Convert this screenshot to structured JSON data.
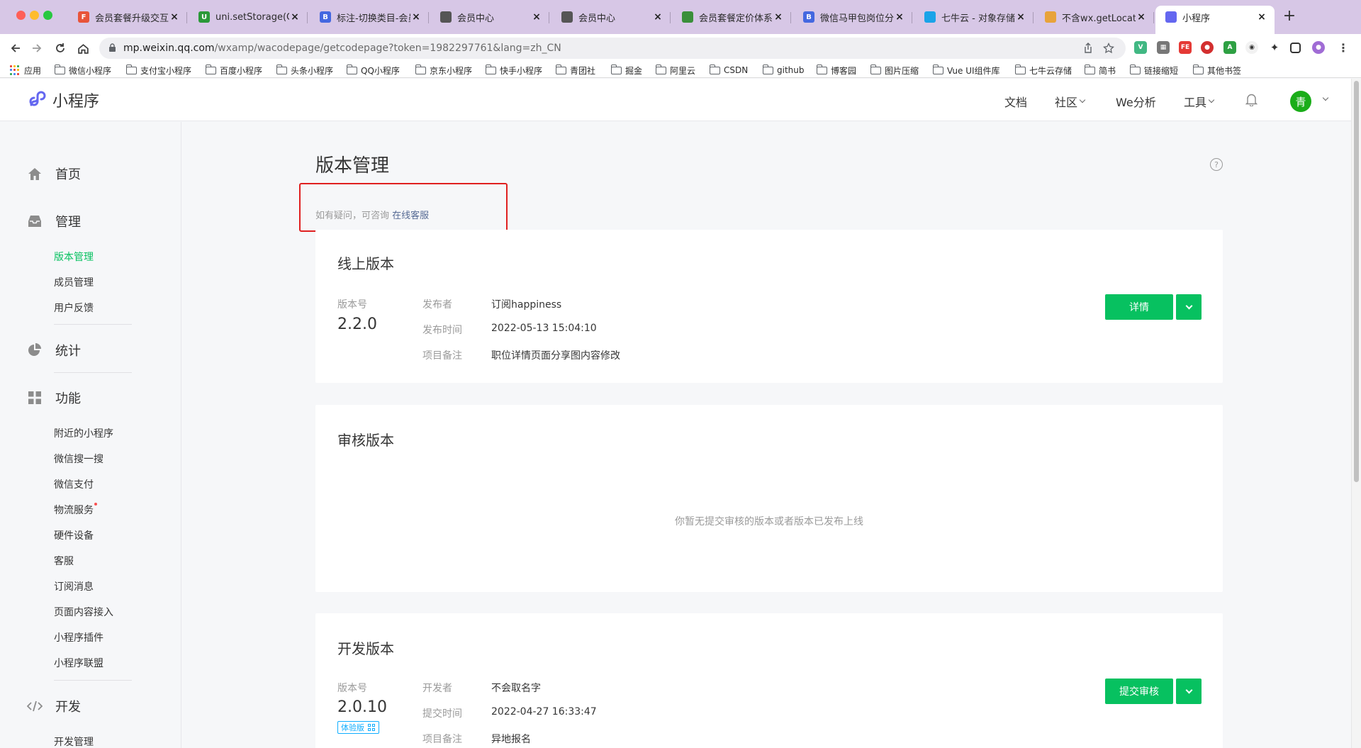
{
  "browser": {
    "tabs": [
      {
        "title": "会员套餐升级交互文档",
        "fav_color": "#e8543a",
        "fav_text": "F"
      },
      {
        "title": "uni.setStorage(OBJECT)",
        "fav_color": "#2b9939",
        "fav_text": "U"
      },
      {
        "title": "标注-切换类目-会员中心",
        "fav_color": "#4468e0",
        "fav_text": "B"
      },
      {
        "title": "会员中心",
        "fav_color": "#555555",
        "fav_text": ""
      },
      {
        "title": "会员中心",
        "fav_color": "#555555",
        "fav_text": ""
      },
      {
        "title": "会员套餐定价体系MRD",
        "fav_color": "#3a8f3a",
        "fav_text": ""
      },
      {
        "title": "微信马甲包岗位分享",
        "fav_color": "#4468e0",
        "fav_text": "B"
      },
      {
        "title": "七牛云 - 对象存储",
        "fav_color": "#1aa3e8",
        "fav_text": ""
      },
      {
        "title": "不含wx.getLocation",
        "fav_color": "#e8a33a",
        "fav_text": ""
      },
      {
        "title": "小程序",
        "fav_color": "#6467f0",
        "fav_text": ""
      }
    ],
    "close_glyph": "×",
    "newtab_glyph": "+",
    "url_host": "mp.weixin.qq.com",
    "url_path": "/wxamp/wacodepage/getcodepage?token=1982297761&lang=zh_CN",
    "bookmarks": [
      "应用",
      "微信小程序",
      "支付宝小程序",
      "百度小程序",
      "头条小程序",
      "QQ小程序",
      "京东小程序",
      "快手小程序",
      "青团社",
      "掘金",
      "阿里云",
      "CSDN",
      "github",
      "博客园",
      "图片压缩",
      "Vue UI组件库",
      "七牛云存储",
      "简书",
      "链接缩短",
      "其他书签"
    ]
  },
  "header": {
    "brand": "小程序",
    "nav": [
      {
        "label": "文档",
        "dropdown": false
      },
      {
        "label": "社区",
        "dropdown": true
      },
      {
        "label": "We分析",
        "dropdown": false
      },
      {
        "label": "工具",
        "dropdown": true
      }
    ],
    "avatar_text": "青"
  },
  "sidebar": {
    "home": "首页",
    "manage": {
      "label": "管理",
      "items": [
        "版本管理",
        "成员管理",
        "用户反馈"
      ],
      "active_index": 0
    },
    "stats": "统计",
    "features": {
      "label": "功能",
      "items": [
        "附近的小程序",
        "微信搜一搜",
        "微信支付",
        "物流服务",
        "硬件设备",
        "客服",
        "订阅消息",
        "页面内容接入",
        "小程序插件",
        "小程序联盟"
      ]
    },
    "dev": {
      "label": "开发",
      "items": [
        "开发管理"
      ]
    }
  },
  "main": {
    "title": "版本管理",
    "help_glyph": "?",
    "consult_text": "如有疑问，可咨询",
    "consult_link": "在线客服",
    "online": {
      "title": "线上版本",
      "version_label": "版本号",
      "version": "2.2.0",
      "publisher_label": "发布者",
      "publisher": "订阅happiness",
      "time_label": "发布时间",
      "time": "2022-05-13 15:04:10",
      "note_label": "项目备注",
      "note": "职位详情页面分享图内容修改",
      "button": "详情"
    },
    "review": {
      "title": "审核版本",
      "empty": "你暂无提交审核的版本或者版本已发布上线"
    },
    "dev": {
      "title": "开发版本",
      "version_label": "版本号",
      "version": "2.0.10",
      "badge": "体验版",
      "developer_label": "开发者",
      "developer": "不会取名字",
      "time_label": "提交时间",
      "time": "2022-04-27 16:33:47",
      "note_label": "项目备注",
      "note": "异地报名",
      "button": "提交审核"
    }
  },
  "colors": {
    "accent_green": "#07c160",
    "link_blue": "#576b95",
    "highlight_red": "#e02020"
  }
}
